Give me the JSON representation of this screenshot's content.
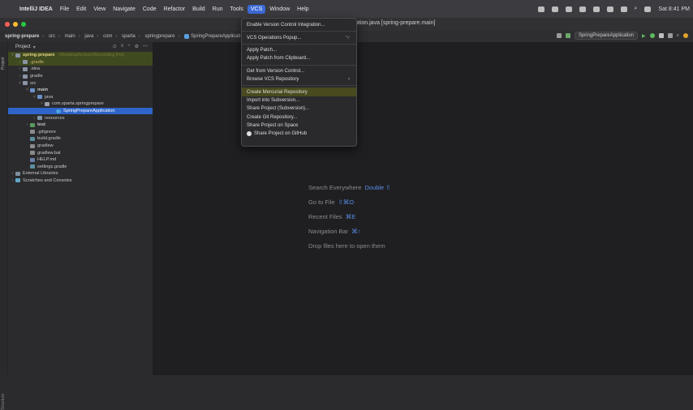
{
  "menubar": {
    "app": "IntelliJ IDEA",
    "items": [
      "File",
      "Edit",
      "View",
      "Navigate",
      "Code",
      "Refactor",
      "Build",
      "Run",
      "Tools",
      "VCS",
      "Window",
      "Help"
    ],
    "clock": "Sat 8:41 PM"
  },
  "window": {
    "title": "ation.java [spring-prepare.main]"
  },
  "breadcrumb": [
    "spring-prepare",
    "src",
    "main",
    "java",
    "com",
    "sparta",
    "springprepare",
    "SpringPrepareApplication"
  ],
  "toolbar": {
    "run_config": "SpringPrepareApplication"
  },
  "project_panel": {
    "title": "Project",
    "stripe_label": "Project",
    "stripe_label_bottom": "Structure",
    "tree": [
      {
        "label": "spring-prepare",
        "path": "~/Desktop/lecture/Recording Proj"
      },
      {
        "label": ".gradle"
      },
      {
        "label": ".idea"
      },
      {
        "label": "gradle"
      },
      {
        "label": "src"
      },
      {
        "label": "main"
      },
      {
        "label": "java"
      },
      {
        "label": "com.sparta.springprepare"
      },
      {
        "label": "SpringPrepareApplication"
      },
      {
        "label": "resources"
      },
      {
        "label": "test"
      },
      {
        "label": ".gitignore"
      },
      {
        "label": "build.gradle"
      },
      {
        "label": "gradlew"
      },
      {
        "label": "gradlew.bat"
      },
      {
        "label": "HELP.md"
      },
      {
        "label": "settings.gradle"
      },
      {
        "label": "External Libraries"
      },
      {
        "label": "Scratches and Consoles"
      }
    ]
  },
  "vcs_menu": {
    "items": [
      "Enable Version Control Integration...",
      "VCS Operations Popup...",
      "Apply Patch...",
      "Apply Patch from Clipboard...",
      "Get from Version Control...",
      "Browse VCS Repository",
      "Create Mercurial Repository",
      "Import into Subversion...",
      "Share Project (Subversion)...",
      "Create Git Repository...",
      "Share Project on Space",
      "Share Project on GitHub"
    ],
    "popup_shortcut": "^V"
  },
  "editor_hints": [
    {
      "text": "Search Everywhere",
      "key": "Double ⇧"
    },
    {
      "text": "Go to File",
      "key": "⇧⌘O"
    },
    {
      "text": "Recent Files",
      "key": "⌘E"
    },
    {
      "text": "Navigation Bar",
      "key": "⌘↑"
    },
    {
      "text": "Drop files here to open them",
      "key": ""
    }
  ],
  "colors": {
    "accent": "#2f65ca",
    "menu_highlight": "#494a1e",
    "hint_key": "#5b8ee8"
  }
}
